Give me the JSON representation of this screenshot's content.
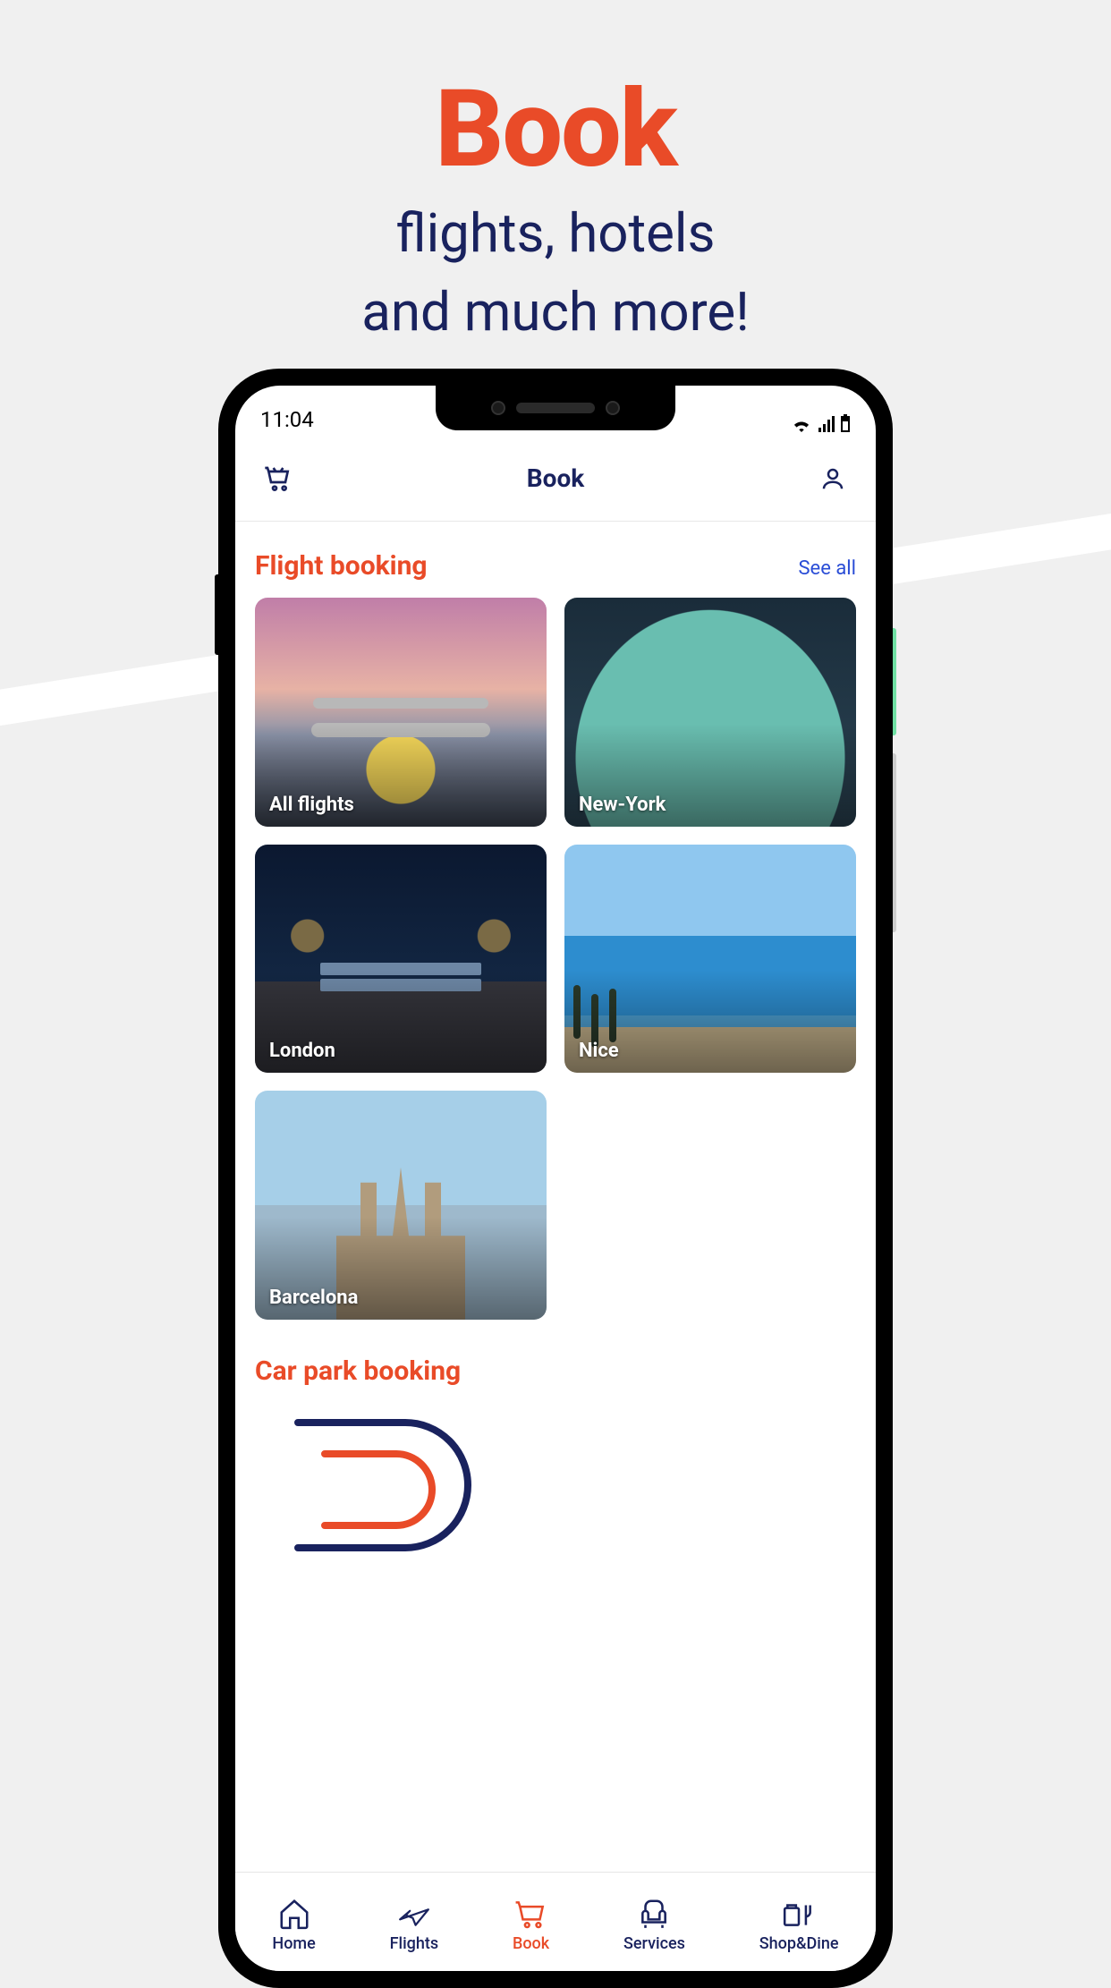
{
  "promo": {
    "title": "Book",
    "subtitle_line1": "flights, hotels",
    "subtitle_line2": "and much more!"
  },
  "statusbar": {
    "time": "11:04"
  },
  "header": {
    "title": "Book"
  },
  "flight_booking": {
    "title": "Flight booking",
    "see_all": "See all",
    "cards": [
      {
        "label": "All flights"
      },
      {
        "label": "New-York"
      },
      {
        "label": "London"
      },
      {
        "label": "Nice"
      },
      {
        "label": "Barcelona"
      }
    ]
  },
  "car_park": {
    "title": "Car park booking"
  },
  "tabs": [
    {
      "label": "Home"
    },
    {
      "label": "Flights"
    },
    {
      "label": "Book"
    },
    {
      "label": "Services"
    },
    {
      "label": "Shop&Dine"
    }
  ],
  "active_tab_index": 2,
  "colors": {
    "accent": "#E94B28",
    "navy": "#19225e",
    "link": "#2a4dd6"
  }
}
